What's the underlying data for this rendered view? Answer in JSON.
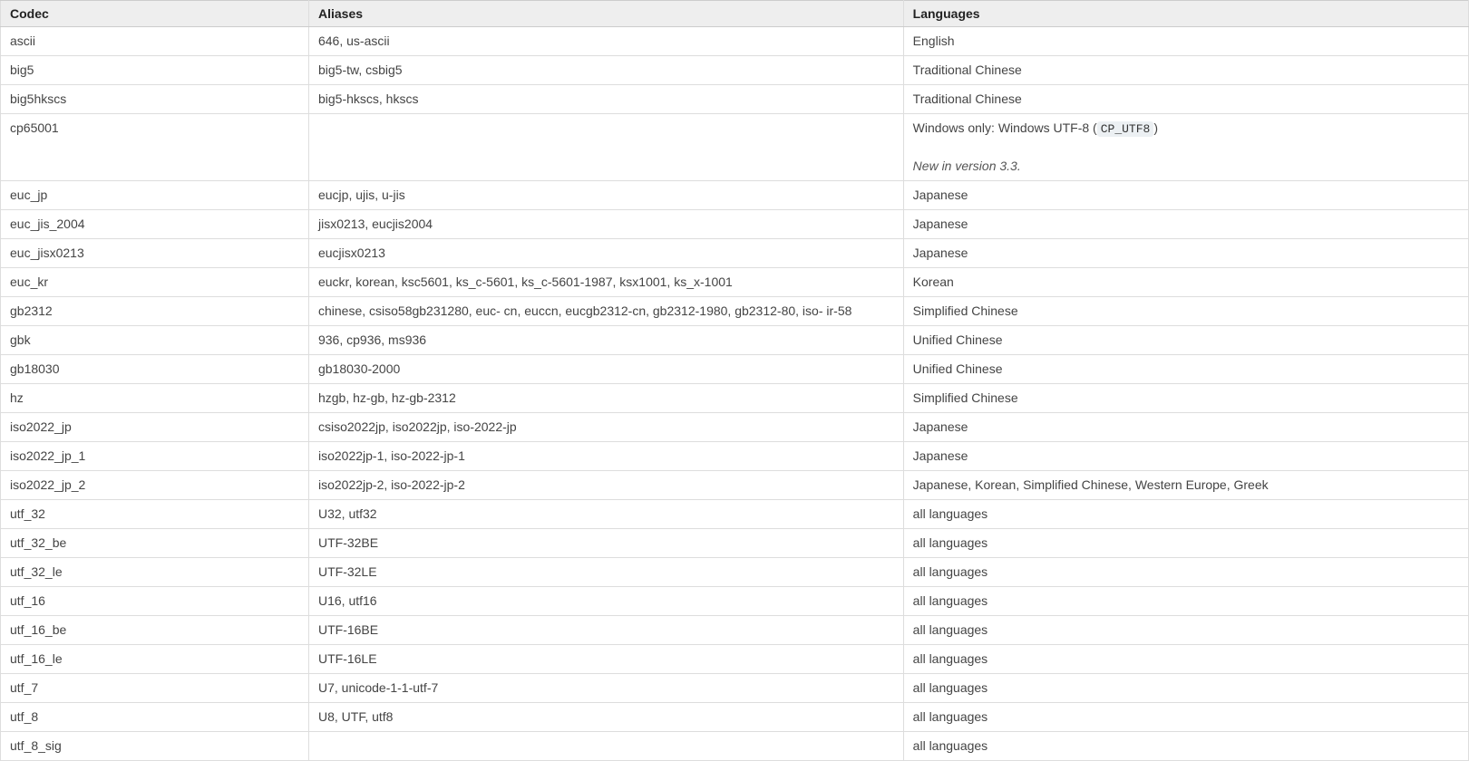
{
  "headers": {
    "codec": "Codec",
    "aliases": "Aliases",
    "languages": "Languages"
  },
  "rows": [
    {
      "codec": "ascii",
      "aliases": "646, us-ascii",
      "languages": "English"
    },
    {
      "codec": "big5",
      "aliases": "big5-tw, csbig5",
      "languages": "Traditional Chinese"
    },
    {
      "codec": "big5hkscs",
      "aliases": "big5-hkscs, hkscs",
      "languages": "Traditional Chinese"
    },
    {
      "codec": "cp65001",
      "aliases": "",
      "languages_prefix": "Windows only: Windows UTF-8 (",
      "languages_code": "CP_UTF8",
      "languages_suffix": ")",
      "version_note": "New in version 3.3."
    },
    {
      "codec": "euc_jp",
      "aliases": "eucjp, ujis, u-jis",
      "languages": "Japanese"
    },
    {
      "codec": "euc_jis_2004",
      "aliases": "jisx0213, eucjis2004",
      "languages": "Japanese"
    },
    {
      "codec": "euc_jisx0213",
      "aliases": "eucjisx0213",
      "languages": "Japanese"
    },
    {
      "codec": "euc_kr",
      "aliases": "euckr, korean, ksc5601, ks_c-5601, ks_c-5601-1987, ksx1001, ks_x-1001",
      "languages": "Korean"
    },
    {
      "codec": "gb2312",
      "aliases": "chinese, csiso58gb231280, euc- cn, euccn, eucgb2312-cn, gb2312-1980, gb2312-80, iso- ir-58",
      "languages": "Simplified Chinese"
    },
    {
      "codec": "gbk",
      "aliases": "936, cp936, ms936",
      "languages": "Unified Chinese"
    },
    {
      "codec": "gb18030",
      "aliases": "gb18030-2000",
      "languages": "Unified Chinese"
    },
    {
      "codec": "hz",
      "aliases": "hzgb, hz-gb, hz-gb-2312",
      "languages": "Simplified Chinese"
    },
    {
      "codec": "iso2022_jp",
      "aliases": "csiso2022jp, iso2022jp, iso-2022-jp",
      "languages": "Japanese"
    },
    {
      "codec": "iso2022_jp_1",
      "aliases": "iso2022jp-1, iso-2022-jp-1",
      "languages": "Japanese"
    },
    {
      "codec": "iso2022_jp_2",
      "aliases": "iso2022jp-2, iso-2022-jp-2",
      "languages": "Japanese, Korean, Simplified Chinese, Western Europe, Greek"
    },
    {
      "codec": "utf_32",
      "aliases": "U32, utf32",
      "languages": "all languages"
    },
    {
      "codec": "utf_32_be",
      "aliases": "UTF-32BE",
      "languages": "all languages"
    },
    {
      "codec": "utf_32_le",
      "aliases": "UTF-32LE",
      "languages": "all languages"
    },
    {
      "codec": "utf_16",
      "aliases": "U16, utf16",
      "languages": "all languages"
    },
    {
      "codec": "utf_16_be",
      "aliases": "UTF-16BE",
      "languages": "all languages"
    },
    {
      "codec": "utf_16_le",
      "aliases": "UTF-16LE",
      "languages": "all languages"
    },
    {
      "codec": "utf_7",
      "aliases": "U7, unicode-1-1-utf-7",
      "languages": "all languages"
    },
    {
      "codec": "utf_8",
      "aliases": "U8, UTF, utf8",
      "languages": "all languages"
    },
    {
      "codec": "utf_8_sig",
      "aliases": "",
      "languages": "all languages"
    }
  ]
}
